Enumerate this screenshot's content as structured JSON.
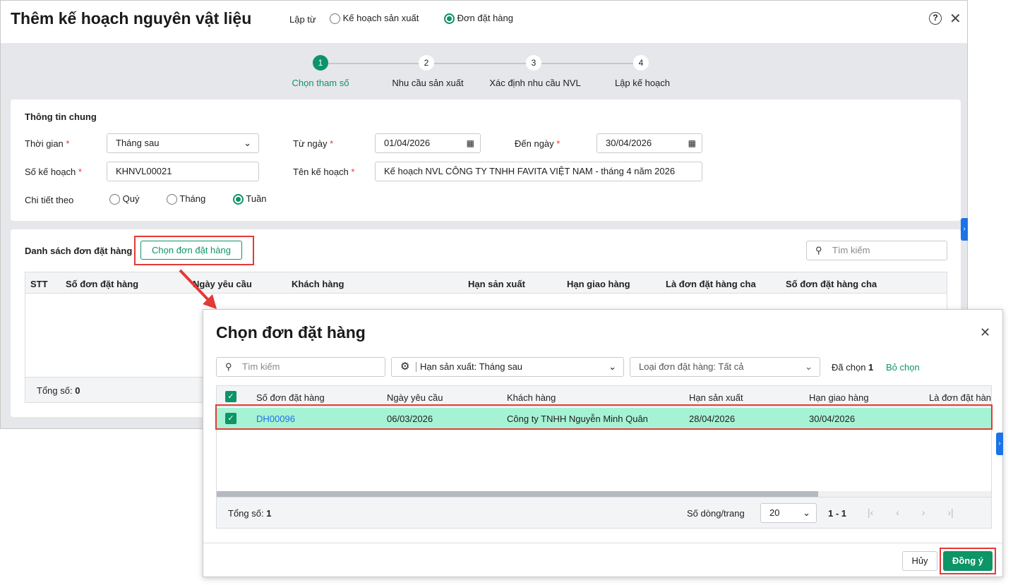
{
  "window": {
    "title": "Thêm kế hoạch nguyên vật liệu",
    "source_label": "Lập từ",
    "source_options": [
      "Kế hoạch sản xuất",
      "Đơn đặt hàng"
    ],
    "source_selected": "Đơn đặt hàng"
  },
  "steps": [
    {
      "n": "1",
      "label": "Chọn tham số"
    },
    {
      "n": "2",
      "label": "Nhu cầu sản xuất"
    },
    {
      "n": "3",
      "label": "Xác định nhu cầu NVL"
    },
    {
      "n": "4",
      "label": "Lập kế hoạch"
    }
  ],
  "general": {
    "heading": "Thông tin chung",
    "time_label": "Thời gian",
    "time_value": "Tháng sau",
    "from_label": "Từ ngày",
    "from_value": "01/04/2026",
    "to_label": "Đến ngày",
    "to_value": "30/04/2026",
    "code_label": "Số kế hoạch",
    "code_value": "KHNVL00021",
    "name_label": "Tên kế hoạch",
    "name_value": "Kế hoạch NVL CÔNG TY TNHH FAVITA VIỆT NAM - tháng 4 năm 2026",
    "detail_label": "Chi tiết theo",
    "detail_options": [
      "Quý",
      "Tháng",
      "Tuần"
    ],
    "detail_selected": "Tuần",
    "required_mark": "*"
  },
  "orders": {
    "heading": "Danh sách đơn đặt hàng",
    "choose_button": "Chọn đơn đặt hàng",
    "search_placeholder": "Tìm kiếm",
    "columns": [
      "STT",
      "Số đơn đặt hàng",
      "Ngày yêu cầu",
      "Khách hàng",
      "Hạn sản xuất",
      "Hạn giao hàng",
      "Là đơn đặt hàng cha",
      "Số đơn đặt hàng cha"
    ],
    "total_label": "Tổng số:",
    "total": "0"
  },
  "modal": {
    "title": "Chọn đơn đặt hàng",
    "search_placeholder": "Tìm kiếm",
    "filter_production": "Hạn sản xuất: Tháng sau",
    "filter_type": "Loại đơn đặt hàng: Tất cả",
    "selected_label": "Đã chọn",
    "selected_count": "1",
    "deselect": "Bỏ chọn",
    "columns": [
      "Số đơn đặt hàng",
      "Ngày yêu cầu",
      "Khách hàng",
      "Hạn sản xuất",
      "Hạn giao hàng",
      "Là đơn đặt hàn"
    ],
    "rows": [
      {
        "code": "DH00096",
        "date": "06/03/2026",
        "customer": "Công ty TNHH Nguyễn Minh Quân",
        "production": "28/04/2026",
        "delivery": "30/04/2026"
      }
    ],
    "total_label": "Tổng số:",
    "total": "1",
    "page_size_label": "Số dòng/trang",
    "page_size": "20",
    "range": "1 - 1",
    "cancel": "Hủy",
    "ok": "Đồng ý"
  },
  "colors": {
    "accent": "#0d9467",
    "selected_row": "#a6f2d4",
    "highlight": "#e53935",
    "link": "#1a73e8"
  }
}
